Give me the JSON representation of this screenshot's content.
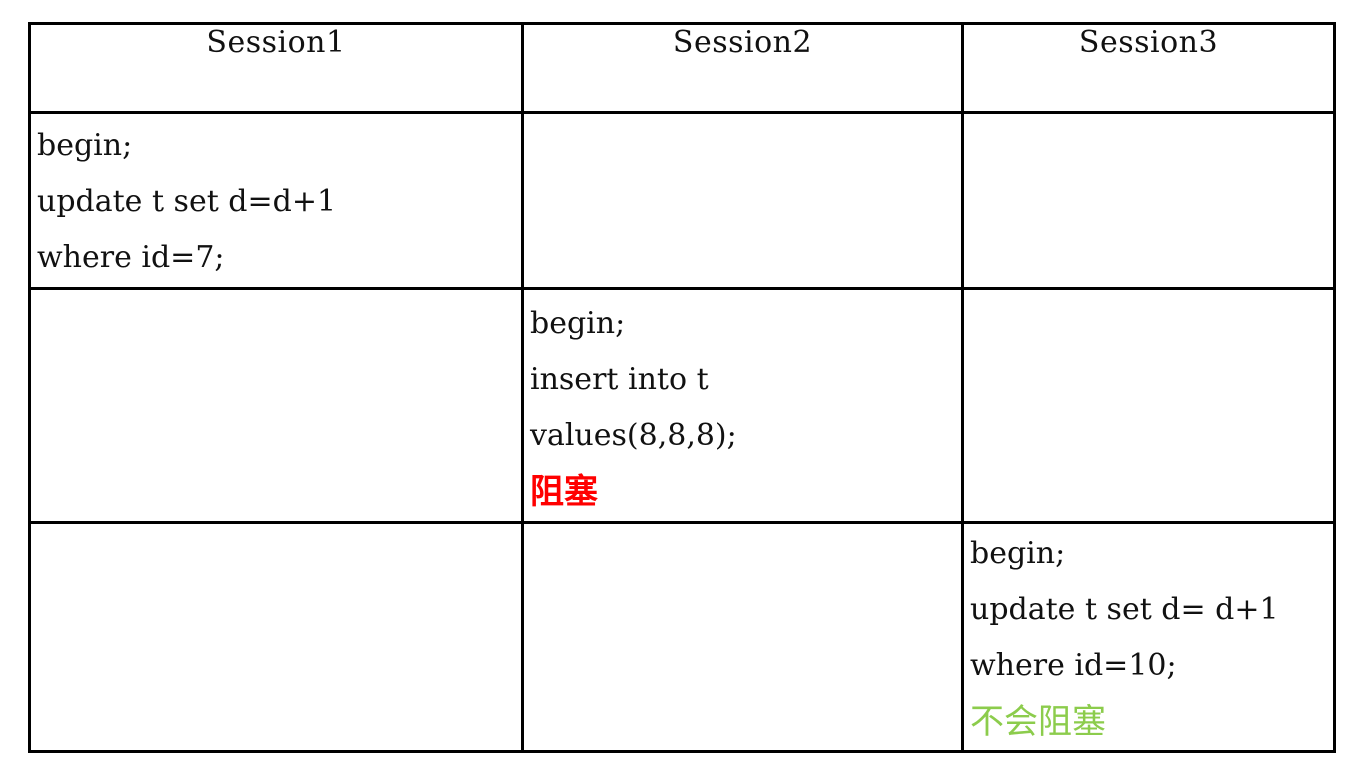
{
  "headers": [
    "Session1",
    "Session2",
    "Session3"
  ],
  "session1": {
    "lines": [
      "begin;",
      "update t set d=d+1",
      "where id=7;"
    ]
  },
  "session2": {
    "lines": [
      "begin;",
      "insert into t",
      "values(8,8,8);"
    ],
    "status": "阻塞",
    "status_color": "#ff0000"
  },
  "session3": {
    "lines": [
      "begin;",
      "update t set d= d+1",
      "where id=10;"
    ],
    "status": "不会阻塞",
    "status_color": "#8ccc4c"
  }
}
